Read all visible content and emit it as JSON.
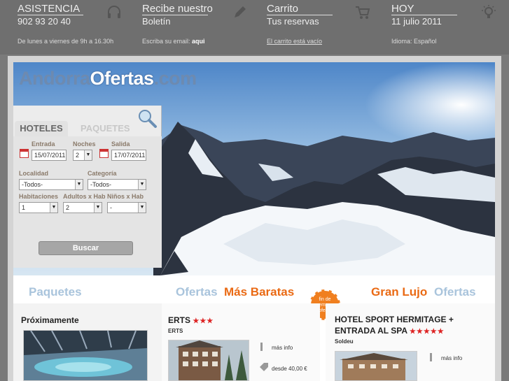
{
  "topbar": {
    "asistencia": {
      "title": "ASISTENCIA",
      "phone": "902 93 20 40",
      "hours": "De lunes a viernes de 9h a 16.30h",
      "icon": "headset-icon"
    },
    "boletin": {
      "title": "Recibe nuestro",
      "sub": "Boletín",
      "text": "Escriba su email:",
      "link": "aqui",
      "icon": "pencil-icon"
    },
    "carrito": {
      "title": "Carrito",
      "sub": "Tus reservas",
      "status": "El carrito está vacío",
      "icon": "cart-icon"
    },
    "hoy": {
      "title": "HOY",
      "date": "11 julio 2011",
      "language": "Idioma: Español",
      "icon": "lightbulb-icon"
    }
  },
  "logo": {
    "part1": "Andorra",
    "part2": "Ofertas",
    "part3": ".com"
  },
  "search": {
    "tab_hoteles": "HOTELES",
    "tab_paquetes": "PAQUETES",
    "entrada_label": "Entrada",
    "entrada_value": "15/07/2011",
    "noches_label": "Noches",
    "noches_value": "2",
    "salida_label": "Salida",
    "salida_value": "17/07/2011",
    "localidad_label": "Localidad",
    "localidad_value": "-Todos-",
    "categoria_label": "Categoría",
    "categoria_value": "-Todos-",
    "habitaciones_label": "Habitaciones",
    "habitaciones_value": "1",
    "adultos_label": "Adultos x Hab",
    "adultos_value": "2",
    "ninos_label": "Niños x Hab",
    "ninos_value": "-",
    "buscar": "Buscar"
  },
  "sections": {
    "paquetes": "Paquetes",
    "ofertas_a": "Ofertas",
    "mas_baratas": "Más Baratas",
    "gran_lujo": "Gran Lujo",
    "ofertas_b": "Ofertas",
    "badge": "fin de semana oferta"
  },
  "col1": {
    "title": "Próximamente"
  },
  "col2": {
    "title": "ERTS",
    "stars": "★★★",
    "location": "ERTS",
    "mas_info": "más info",
    "price": "desde 40,00 €"
  },
  "col3": {
    "title_line1": "HOTEL SPORT HERMITAGE +",
    "title_line2": "ENTRADA AL SPA",
    "stars": "★★★★★",
    "location": "Soldeu",
    "mas_info": "más info"
  },
  "colors": {
    "accent_orange": "#ea6a14",
    "light_blue": "#a9c4dc",
    "star_red": "#d22222"
  }
}
